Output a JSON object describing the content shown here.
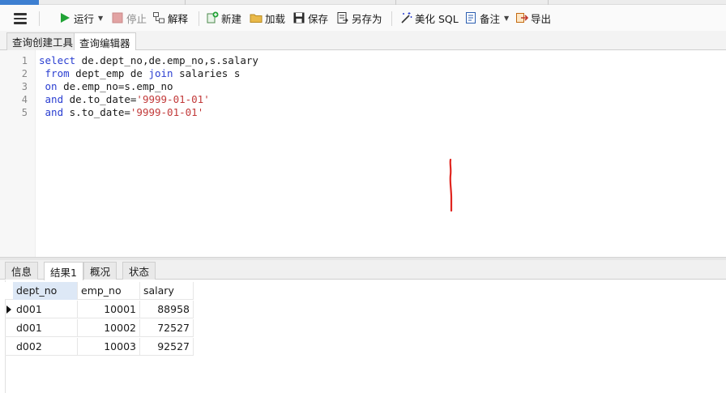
{
  "toolbar": {
    "run_label": "运行",
    "stop_label": "停止",
    "explain_label": "解释",
    "new_label": "新建",
    "load_label": "加载",
    "save_label": "保存",
    "saveas_label": "另存为",
    "beautify_label": "美化 SQL",
    "notes_label": "备注",
    "export_label": "导出",
    "colors": {
      "run_green": "#21a336",
      "accent_blue": "#3d7fd1"
    }
  },
  "tabs": [
    {
      "label": "查询创建工具",
      "active": false
    },
    {
      "label": "查询编辑器",
      "active": true
    }
  ],
  "editor": {
    "line_numbers": [
      "1",
      "2",
      "3",
      "4",
      "5"
    ],
    "lines": [
      [
        {
          "t": "select",
          "k": "kw"
        },
        {
          "t": " de.dept_no,de.emp_no,s.salary",
          "k": ""
        }
      ],
      [
        {
          "t": " ",
          "k": ""
        },
        {
          "t": "from",
          "k": "kw"
        },
        {
          "t": " dept_emp de ",
          "k": ""
        },
        {
          "t": "join",
          "k": "kw"
        },
        {
          "t": " salaries s",
          "k": ""
        }
      ],
      [
        {
          "t": " ",
          "k": ""
        },
        {
          "t": "on",
          "k": "kw"
        },
        {
          "t": " de.emp_no=s.emp_no",
          "k": ""
        }
      ],
      [
        {
          "t": " ",
          "k": ""
        },
        {
          "t": "and",
          "k": "kw"
        },
        {
          "t": " de.to_date=",
          "k": ""
        },
        {
          "t": "'9999-01-01'",
          "k": "str"
        }
      ],
      [
        {
          "t": " ",
          "k": ""
        },
        {
          "t": "and",
          "k": "kw"
        },
        {
          "t": " s.to_date=",
          "k": ""
        },
        {
          "t": "'9999-01-01'",
          "k": "str"
        }
      ]
    ],
    "colors": {
      "keyword": "#2a3ed1",
      "string": "#c23a3a",
      "annotation": "#e0251f"
    }
  },
  "result_tabs": [
    {
      "label": "信息",
      "active": false
    },
    {
      "label": "结果1",
      "active": true
    },
    {
      "label": "概况",
      "active": false
    },
    {
      "label": "状态",
      "active": false
    }
  ],
  "grid": {
    "columns": [
      "dept_no",
      "emp_no",
      "salary"
    ],
    "rows": [
      [
        "d001",
        "10001",
        "88958"
      ],
      [
        "d001",
        "10002",
        "72527"
      ],
      [
        "d002",
        "10003",
        "92527"
      ]
    ],
    "current_row": 0
  }
}
